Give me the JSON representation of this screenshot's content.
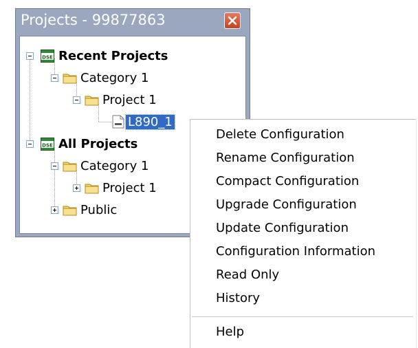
{
  "window": {
    "title": "Projects - 99877863",
    "close_icon": "close-icon"
  },
  "tree": {
    "recent_projects": "Recent Projects",
    "recent_category": "Category 1",
    "recent_project": "Project 1",
    "recent_config": "L890_1",
    "all_projects": "All Projects",
    "all_category": "Category 1",
    "all_project": "Project 1",
    "public": "Public"
  },
  "context_menu": {
    "items": [
      "Delete Configuration",
      "Rename Configuration",
      "Compact Configuration",
      "Upgrade Configuration",
      "Update Configuration",
      "Configuration Information",
      "Read Only",
      "History"
    ],
    "help": "Help"
  },
  "colors": {
    "window_frame": "#9aa7bf",
    "selection": "#316ac5",
    "close_button": "#d9532f"
  }
}
